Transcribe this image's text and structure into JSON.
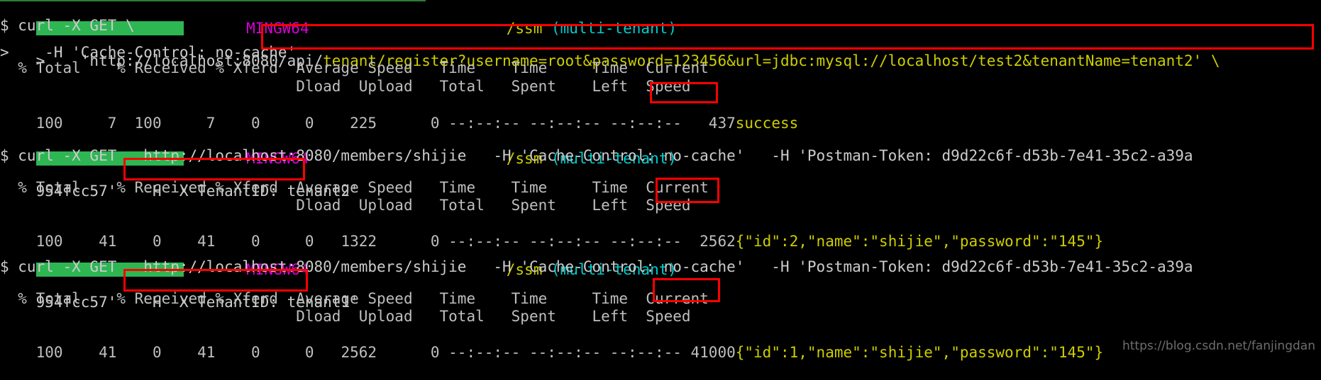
{
  "terminal": {
    "shell": "MINGW64",
    "cwd": "/ssm",
    "branch": "(multi-tenant)",
    "colors": {
      "background": "#000000",
      "foreground": "#cccccc",
      "prompt_block_green": "#2eb653",
      "shell_magenta": "#d700d7",
      "path_yellow": "#cdcd00",
      "branch_cyan": "#00cdcd",
      "annotation_red": "#ff0000"
    },
    "blocks": [
      {
        "name": "register-tenant2",
        "prompt": {
          "block_label": "",
          "shell": "MINGW64",
          "cwd": "/ssm",
          "branch": "(multi-tenant)"
        },
        "command_lines": [
          "$ curl -X GET \\",
          ">    'http://localhost:8080/api/tenant/register?username=root&password=123456&url=jdbc:mysql://localhost/test2&tenantName=tenant2' \\",
          ">    -H 'Cache-Control: no-cache'"
        ],
        "command_prefix": "$ curl -X GET \\",
        "url_plain": ">    'http://localhost:8080/api/",
        "url_highlighted": "tenant/register?username=root&password=123456&url=jdbc:mysql://localhost/test2&tenantName=tenant2' \\",
        "header_line": ">    -H 'Cache-Control: no-cache'",
        "progress_header_1": "  % Total    % Received % Xferd  Average Speed   Time    Time     Time  Current",
        "progress_header_2": "                                 Dload  Upload   Total   Spent    Left  Speed",
        "progress_row": "100     7  100     7    0     0    225      0 --:--:-- --:--:-- --:--:--   437",
        "response": "success"
      },
      {
        "name": "query-tenant2",
        "prompt": {
          "shell": "MINGW64",
          "cwd": "/ssm",
          "branch": "(multi-tenant)"
        },
        "command_line": "$ curl -X GET   http://localhost:8080/members/shijie   -H 'Cache-Control: no-cache'   -H 'Postman-Token: d9d22c6f-d53b-7e41-35c2-a39a",
        "token_continuation": "954fcc57'   -H ",
        "tenant_header": "'X-TenantID: tenant2'",
        "progress_header_1": "  % Total    % Received % Xferd  Average Speed   Time    Time     Time  Current",
        "progress_header_2": "                                 Dload  Upload   Total   Spent    Left  Speed",
        "progress_row": "100    41    0    41    0     0   1322      0 --:--:-- --:--:-- --:--:--  2562",
        "response_highlighted": "{\"id\":2,",
        "response_rest": "\"name\":\"shijie\",\"password\":\"145\"}"
      },
      {
        "name": "query-tenant1",
        "prompt": {
          "shell": "MINGW64",
          "cwd": "/ssm",
          "branch": "(multi-tenant)"
        },
        "command_line": "$ curl -X GET   http://localhost:8080/members/shijie   -H 'Cache-Control: no-cache'   -H 'Postman-Token: d9d22c6f-d53b-7e41-35c2-a39a",
        "token_continuation": "954fcc57'   -H ",
        "tenant_header": "'X-TenantID: tenant1'",
        "progress_header_1": "  % Total    % Received % Xferd  Average Speed   Time    Time     Time  Current",
        "progress_header_2": "                                 Dload  Upload   Total   Spent    Left  Speed",
        "progress_row": "100    41    0    41    0     0   2562      0 --:--:-- --:--:-- --:--:-- 41000",
        "response_highlighted": "{\"id\":1,",
        "response_rest": "\"name\":\"shijie\",\"password\":\"145\"}"
      }
    ]
  },
  "watermark": "https://blog.csdn.net/fanjingdan"
}
